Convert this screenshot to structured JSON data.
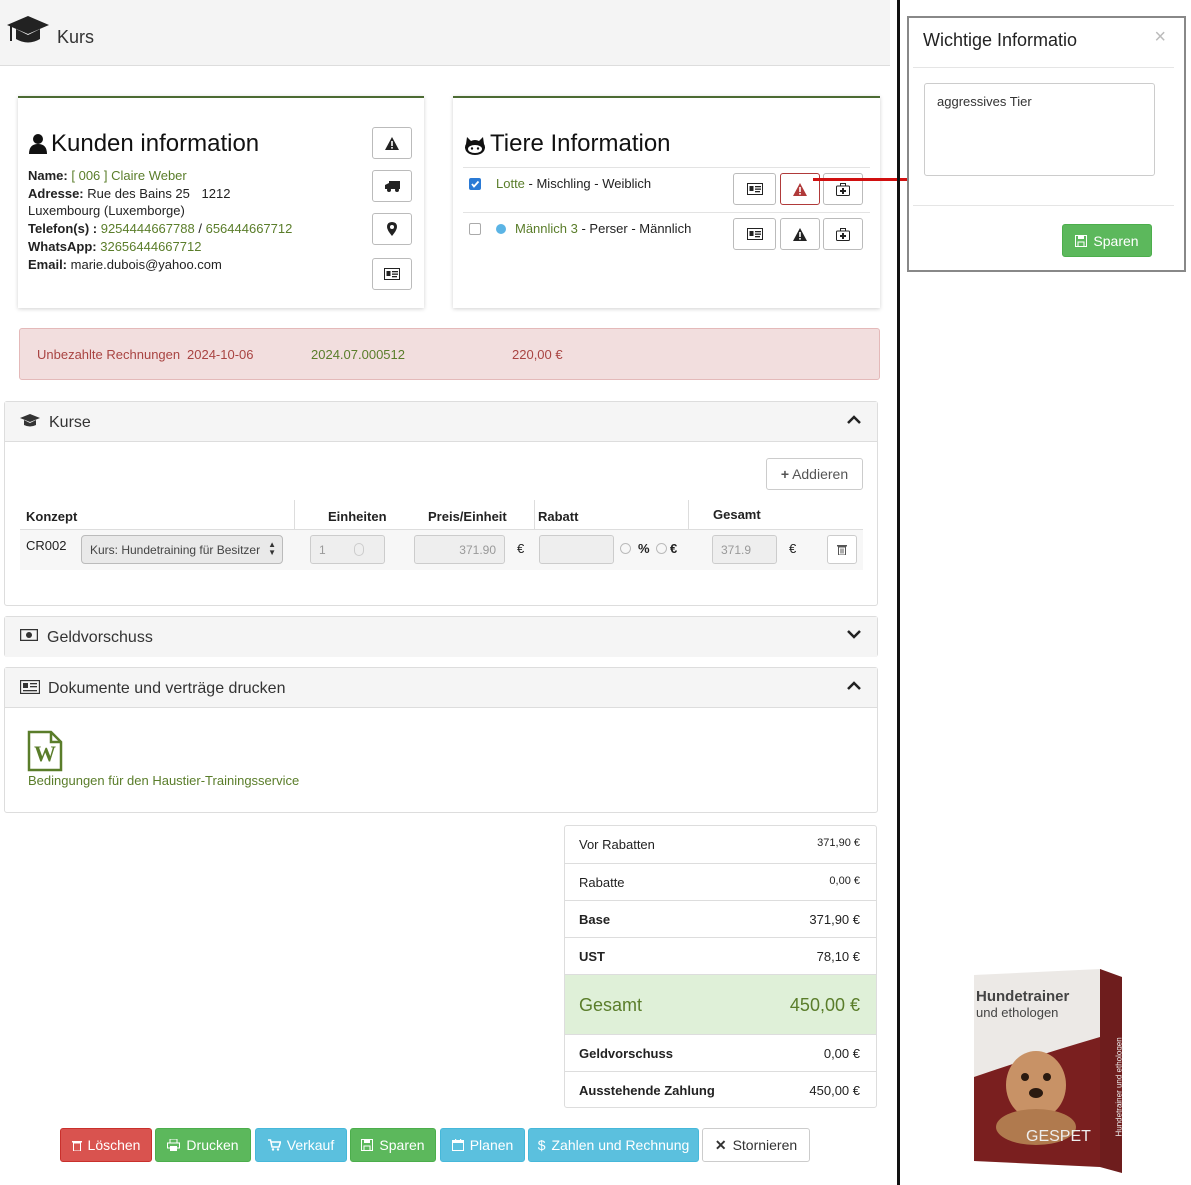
{
  "header": {
    "title": "Kurs"
  },
  "customer": {
    "title": "Kunden information",
    "name_label": "Name:",
    "name_value": "[ 006 ] Claire Weber",
    "address_label": "Adresse:",
    "address_line1": "Rue des Bains 25",
    "address_zip": "1212",
    "address_line2": "Luxembourg (Luxemborge)",
    "phone_label": "Telefon(s) :",
    "phone1": "9254444667788",
    "phone_sep": "/",
    "phone2": "656444667712",
    "whatsapp_label": "WhatsApp:",
    "whatsapp": "32656444667712",
    "email_label": "Email:",
    "email": "marie.dubois@yahoo.com"
  },
  "animals": {
    "title": "Tiere Information",
    "rows": [
      {
        "name": "Lotte",
        "rest": " - Mischling - Weiblich",
        "checked": true
      },
      {
        "name": "Männlich 3",
        "rest": " - Perser - Männlich",
        "checked": false
      }
    ]
  },
  "alert": {
    "label": "Unbezahlte Rechnungen",
    "date": "2024-10-06",
    "invoice": "2024.07.000512",
    "amount": "220,00 €"
  },
  "courses": {
    "title": "Kurse",
    "add_label": "Addieren",
    "columns": [
      "Konzept",
      "Einheiten",
      "Preis/Einheit",
      "Rabatt",
      "Gesamt"
    ],
    "row": {
      "code": "CR002",
      "select": "Kurs: Hundetraining für Besitzer",
      "units": "1",
      "price": "371.90",
      "currency": "€",
      "pct": "%",
      "eur": "€",
      "total": "371.9",
      "total_currency": "€"
    }
  },
  "advance_panel": {
    "title": "Geldvorschuss"
  },
  "documents": {
    "title": "Dokumente und verträge drucken",
    "doc_label": "Bedingungen für den Haustier-Trainingsservice",
    "doc_icon_letter": "W"
  },
  "summary": {
    "before_discount_label": "Vor Rabatten",
    "before_discount": "371,90 €",
    "discount_label": "Rabatte",
    "discount": "0,00 €",
    "base_label": "Base",
    "base": "371,90 €",
    "vat_label": "UST",
    "vat": "78,10 €",
    "total_label": "Gesamt",
    "total": "450,00 €",
    "advance_label": "Geldvorschuss",
    "advance": "0,00 €",
    "pending_label": "Ausstehende Zahlung",
    "pending": "450,00 €"
  },
  "buttons": {
    "delete": "Löschen",
    "print": "Drucken",
    "sell": "Verkauf",
    "save": "Sparen",
    "plan": "Planen",
    "pay": "Zahlen und Rechnung",
    "cancel": "Stornieren"
  },
  "modal": {
    "title": "Wichtige Informatio",
    "close": "×",
    "note": "aggressives Tier",
    "save": "Sparen"
  },
  "product": {
    "title1": "Hundetrainer",
    "title2": "und ethologen",
    "brand": "GESPET",
    "spine": "Hundetrainer und ethologen"
  },
  "colors": {
    "accent_green": "#5a7d2a",
    "alert_bg": "#f2dede",
    "total_bg": "#dff0d8"
  }
}
